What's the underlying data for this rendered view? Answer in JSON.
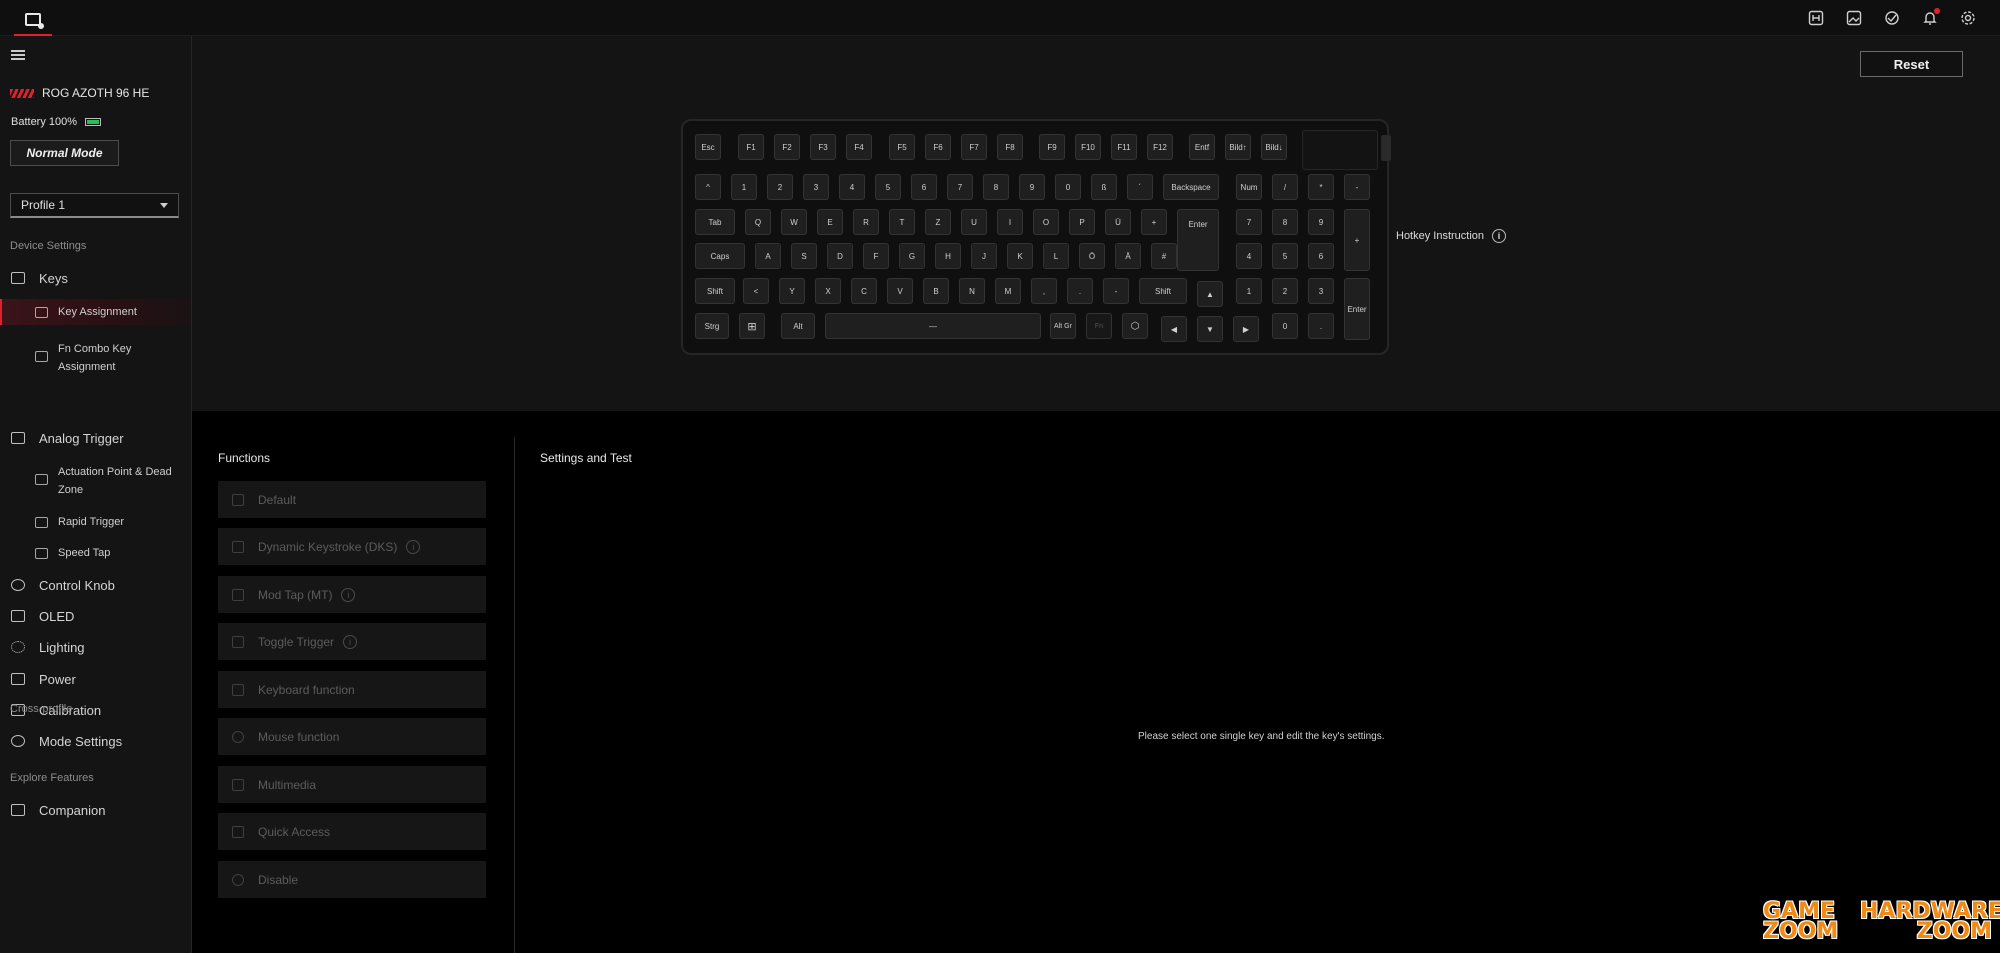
{
  "topbar": {
    "icons": [
      "hotkey-icon",
      "gallery-icon",
      "sync-icon",
      "bell-icon",
      "gear-icon"
    ]
  },
  "sidebar": {
    "device_name": "ROG AZOTH 96 HE",
    "battery_label": "Battery 100%",
    "battery_level": 1.0,
    "mode_button": "Normal Mode",
    "profile": "Profile 1",
    "section_device": "Device Settings",
    "section_cross": "Cross-profile",
    "section_explore": "Explore Features",
    "items": {
      "keys": "Keys",
      "key_assignment": "Key Assignment",
      "fn_combo": "Fn Combo Key Assignment",
      "analog_trigger": "Analog Trigger",
      "actuation": "Actuation Point & Dead Zone",
      "rapid_trigger": "Rapid Trigger",
      "speed_tap": "Speed Tap",
      "control_knob": "Control Knob",
      "oled": "OLED",
      "lighting": "Lighting",
      "power": "Power",
      "calibration": "Calibration",
      "mode_settings": "Mode Settings",
      "companion": "Companion"
    }
  },
  "main": {
    "reset": "Reset",
    "hotkey_instruction": "Hotkey Instruction",
    "info_glyph": "i",
    "functions_title": "Functions",
    "settings_title": "Settings and Test",
    "hint": "Please select one single key and edit the key's settings."
  },
  "functions": {
    "default": "Default",
    "dks": "Dynamic Keystroke (DKS)",
    "mt": "Mod Tap (MT)",
    "toggle": "Toggle Trigger",
    "keyboard": "Keyboard function",
    "mouse": "Mouse function",
    "multimedia": "Multimedia",
    "quick": "Quick Access",
    "disable": "Disable"
  },
  "keys": {
    "esc": "Esc",
    "f1": "F1",
    "f2": "F2",
    "f3": "F3",
    "f4": "F4",
    "f5": "F5",
    "f6": "F6",
    "f7": "F7",
    "f8": "F8",
    "f9": "F9",
    "f10": "F10",
    "f11": "F11",
    "f12": "F12",
    "entf": "Entf",
    "bildup": "Bild↑",
    "bilddown": "Bild↓",
    "caret": "^",
    "n1": "1",
    "n2": "2",
    "n3": "3",
    "n4": "4",
    "n5": "5",
    "n6": "6",
    "n7": "7",
    "n8": "8",
    "n9": "9",
    "n0": "0",
    "sz": "ß",
    "acute": "´",
    "backspace": "Backspace",
    "num": "Num",
    "slash": "/",
    "star": "*",
    "minus": "-",
    "tab": "Tab",
    "q": "Q",
    "w": "W",
    "e": "E",
    "r": "R",
    "t": "T",
    "z": "Z",
    "u": "U",
    "i": "I",
    "o": "O",
    "p": "P",
    "ue": "Ü",
    "plus": "+",
    "enter": "Enter",
    "np7": "7",
    "np8": "8",
    "np9": "9",
    "npplus": "+",
    "caps": "Caps",
    "a": "A",
    "s": "S",
    "d": "D",
    "f": "F",
    "g": "G",
    "h": "H",
    "j": "J",
    "k": "K",
    "l": "L",
    "oe": "Ö",
    "ae": "Ä",
    "hash": "#",
    "np4": "4",
    "np5": "5",
    "np6": "6",
    "shift": "Shift",
    "lt": "<",
    "y": "Y",
    "x": "X",
    "c": "C",
    "v": "V",
    "b": "B",
    "n": "N",
    "m": "M",
    "comma": ",",
    "dot": ".",
    "dash": "-",
    "rshift": "Shift",
    "up": "▲",
    "np1": "1",
    "np2": "2",
    "np3": "3",
    "npenter": "Enter",
    "strg": "Strg",
    "win": "⊞",
    "alt": "Alt",
    "space": "—",
    "altgr": "Alt Gr",
    "fn": "Fn",
    "copilot": "⬡",
    "left": "◀",
    "down": "▼",
    "right": "▶",
    "np0": "0",
    "npdot": "."
  },
  "watermark": {
    "game": "GAME",
    "zoom1": "ZOOM",
    "hardware": "HARDWARE",
    "zoom2": "ZOOM"
  },
  "colors": {
    "accent": "#e0202e",
    "battery": "#21c25b",
    "watermark": "#f08a14"
  }
}
